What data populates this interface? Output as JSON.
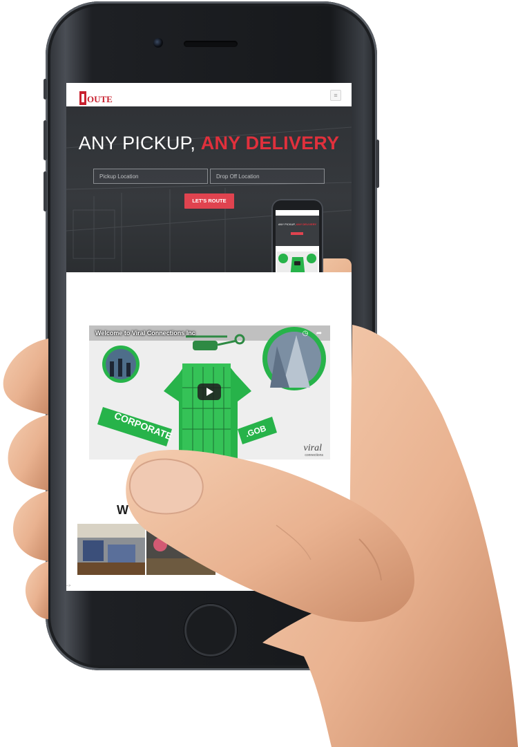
{
  "app": {
    "logo_text": "OUTE",
    "menu_icon": "hamburger-icon"
  },
  "hero": {
    "title_plain": "ANY PICKUP,",
    "title_accent": "ANY DELIVERY",
    "pickup_placeholder": "Pickup Location",
    "dropoff_placeholder": "Drop Off Location",
    "cta_label": "LET'S ROUTE"
  },
  "video": {
    "title": "Welcome to Viral Connections Inc",
    "banner_left": "CORPORATE",
    "banner_right": ".GOB",
    "brand": "viral",
    "brand_sub": "connections",
    "play_icon": "play-icon",
    "clock_icon": "clock-icon",
    "share_icon": "share-icon"
  },
  "section": {
    "heading_partial": "W"
  },
  "footer": {
    "note": "-->"
  },
  "colors": {
    "brand_red": "#c8202e",
    "accent_red": "#e0303c",
    "button_red": "#e0434f",
    "hero_bg": "#33363a",
    "teal": "#2ea6b5",
    "video_green": "#27b34a"
  }
}
